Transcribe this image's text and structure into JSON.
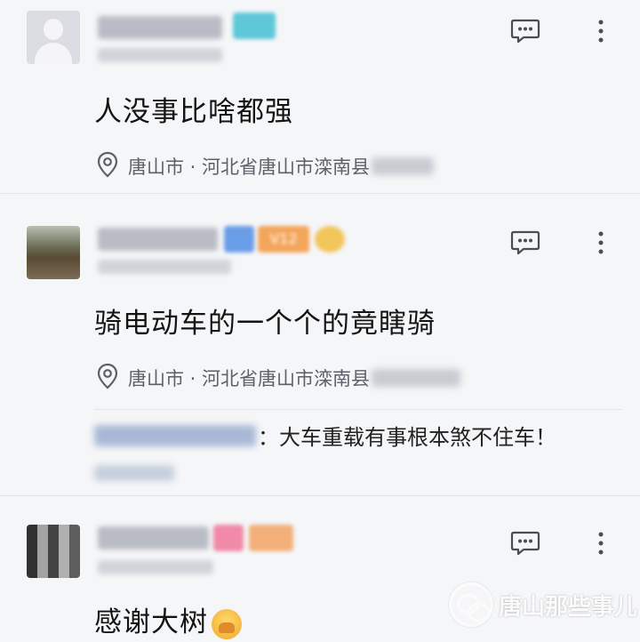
{
  "comments": [
    {
      "text": "人没事比啥都强",
      "location": {
        "label": "唐山市 · 河北省唐山市滦南县"
      },
      "badge_color": "#5ec8d8"
    },
    {
      "text": "骑电动车的一个个的竟瞎骑",
      "location": {
        "label": "唐山市 · 河北省唐山市滦南县"
      },
      "badge_level": "V12",
      "reply": {
        "separator": "：",
        "text": "大车重载有事根本煞不住车！"
      }
    },
    {
      "text": "感谢大树",
      "emoji_icon": "pray-hands-emoji"
    }
  ],
  "watermark": {
    "text": "唐山那些事儿"
  },
  "colors": {
    "background": "#f5f6f8",
    "location_text": "#5d6069",
    "reply_name_blur": "#a8b8d6"
  }
}
